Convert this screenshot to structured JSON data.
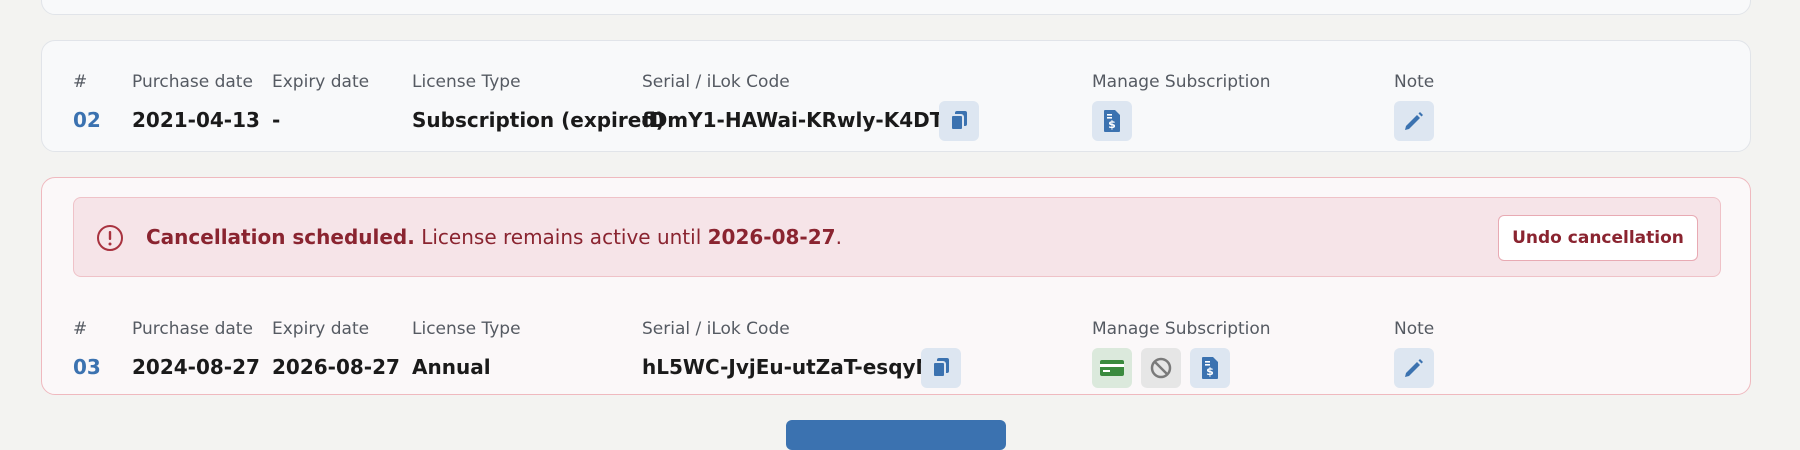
{
  "columns": {
    "num": "#",
    "purchase": "Purchase date",
    "expiry": "Expiry date",
    "type": "License Type",
    "serial": "Serial / iLok Code",
    "manage": "Manage Subscription",
    "note": "Note"
  },
  "licenses": [
    {
      "num": "02",
      "purchase": "2021-04-13",
      "expiry": "-",
      "type": "Subscription (expired)",
      "serial": "fDmY1-HAWai-KRwly-K4DTa",
      "manage_icons": [
        "invoice-icon"
      ]
    },
    {
      "num": "03",
      "purchase": "2024-08-27",
      "expiry": "2026-08-27",
      "type": "Annual",
      "serial": "hL5WC-JvjEu-utZaT-esqyM",
      "manage_icons": [
        "credit-card-icon",
        "cancel-icon",
        "invoice-icon"
      ]
    }
  ],
  "banner": {
    "strong": "Cancellation scheduled.",
    "middle": " License remains active until ",
    "date": "2026-08-27",
    "end": ".",
    "undo_label": "Undo cancellation"
  },
  "colors": {
    "accent": "#3b72b0",
    "danger_text": "#8a2430",
    "danger_bg": "#f6e4e8",
    "card_green": "#3a8a3e"
  }
}
